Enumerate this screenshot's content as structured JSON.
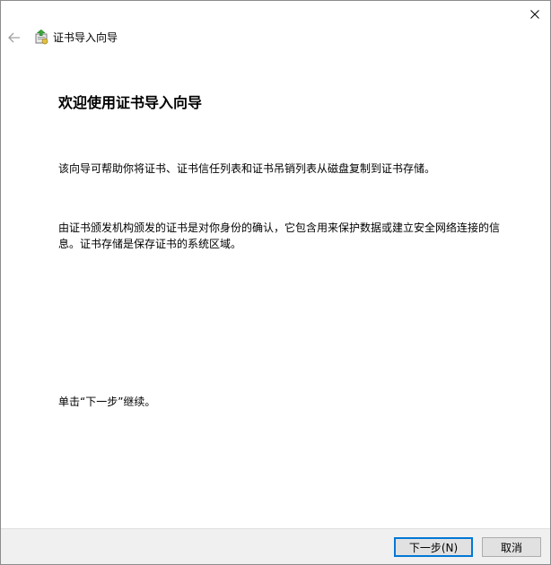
{
  "window": {
    "title": "证书导入向导"
  },
  "icons": {
    "back": "back-arrow-icon",
    "wizard": "certificate-wizard-icon",
    "close": "close-icon"
  },
  "content": {
    "heading": "欢迎使用证书导入向导",
    "paragraph1": "该向导可帮助你将证书、证书信任列表和证书吊销列表从磁盘复制到证书存储。",
    "paragraph2": "由证书颁发机构颁发的证书是对你身份的确认，它包含用来保护数据或建立安全网络连接的信息。证书存储是保存证书的系统区域。",
    "paragraph3": "单击“下一步”继续。"
  },
  "footer": {
    "next_label": "下一步(N)",
    "cancel_label": "取消"
  },
  "colors": {
    "default_button_border": "#0078d7",
    "footer_background": "#f0f0f0"
  }
}
